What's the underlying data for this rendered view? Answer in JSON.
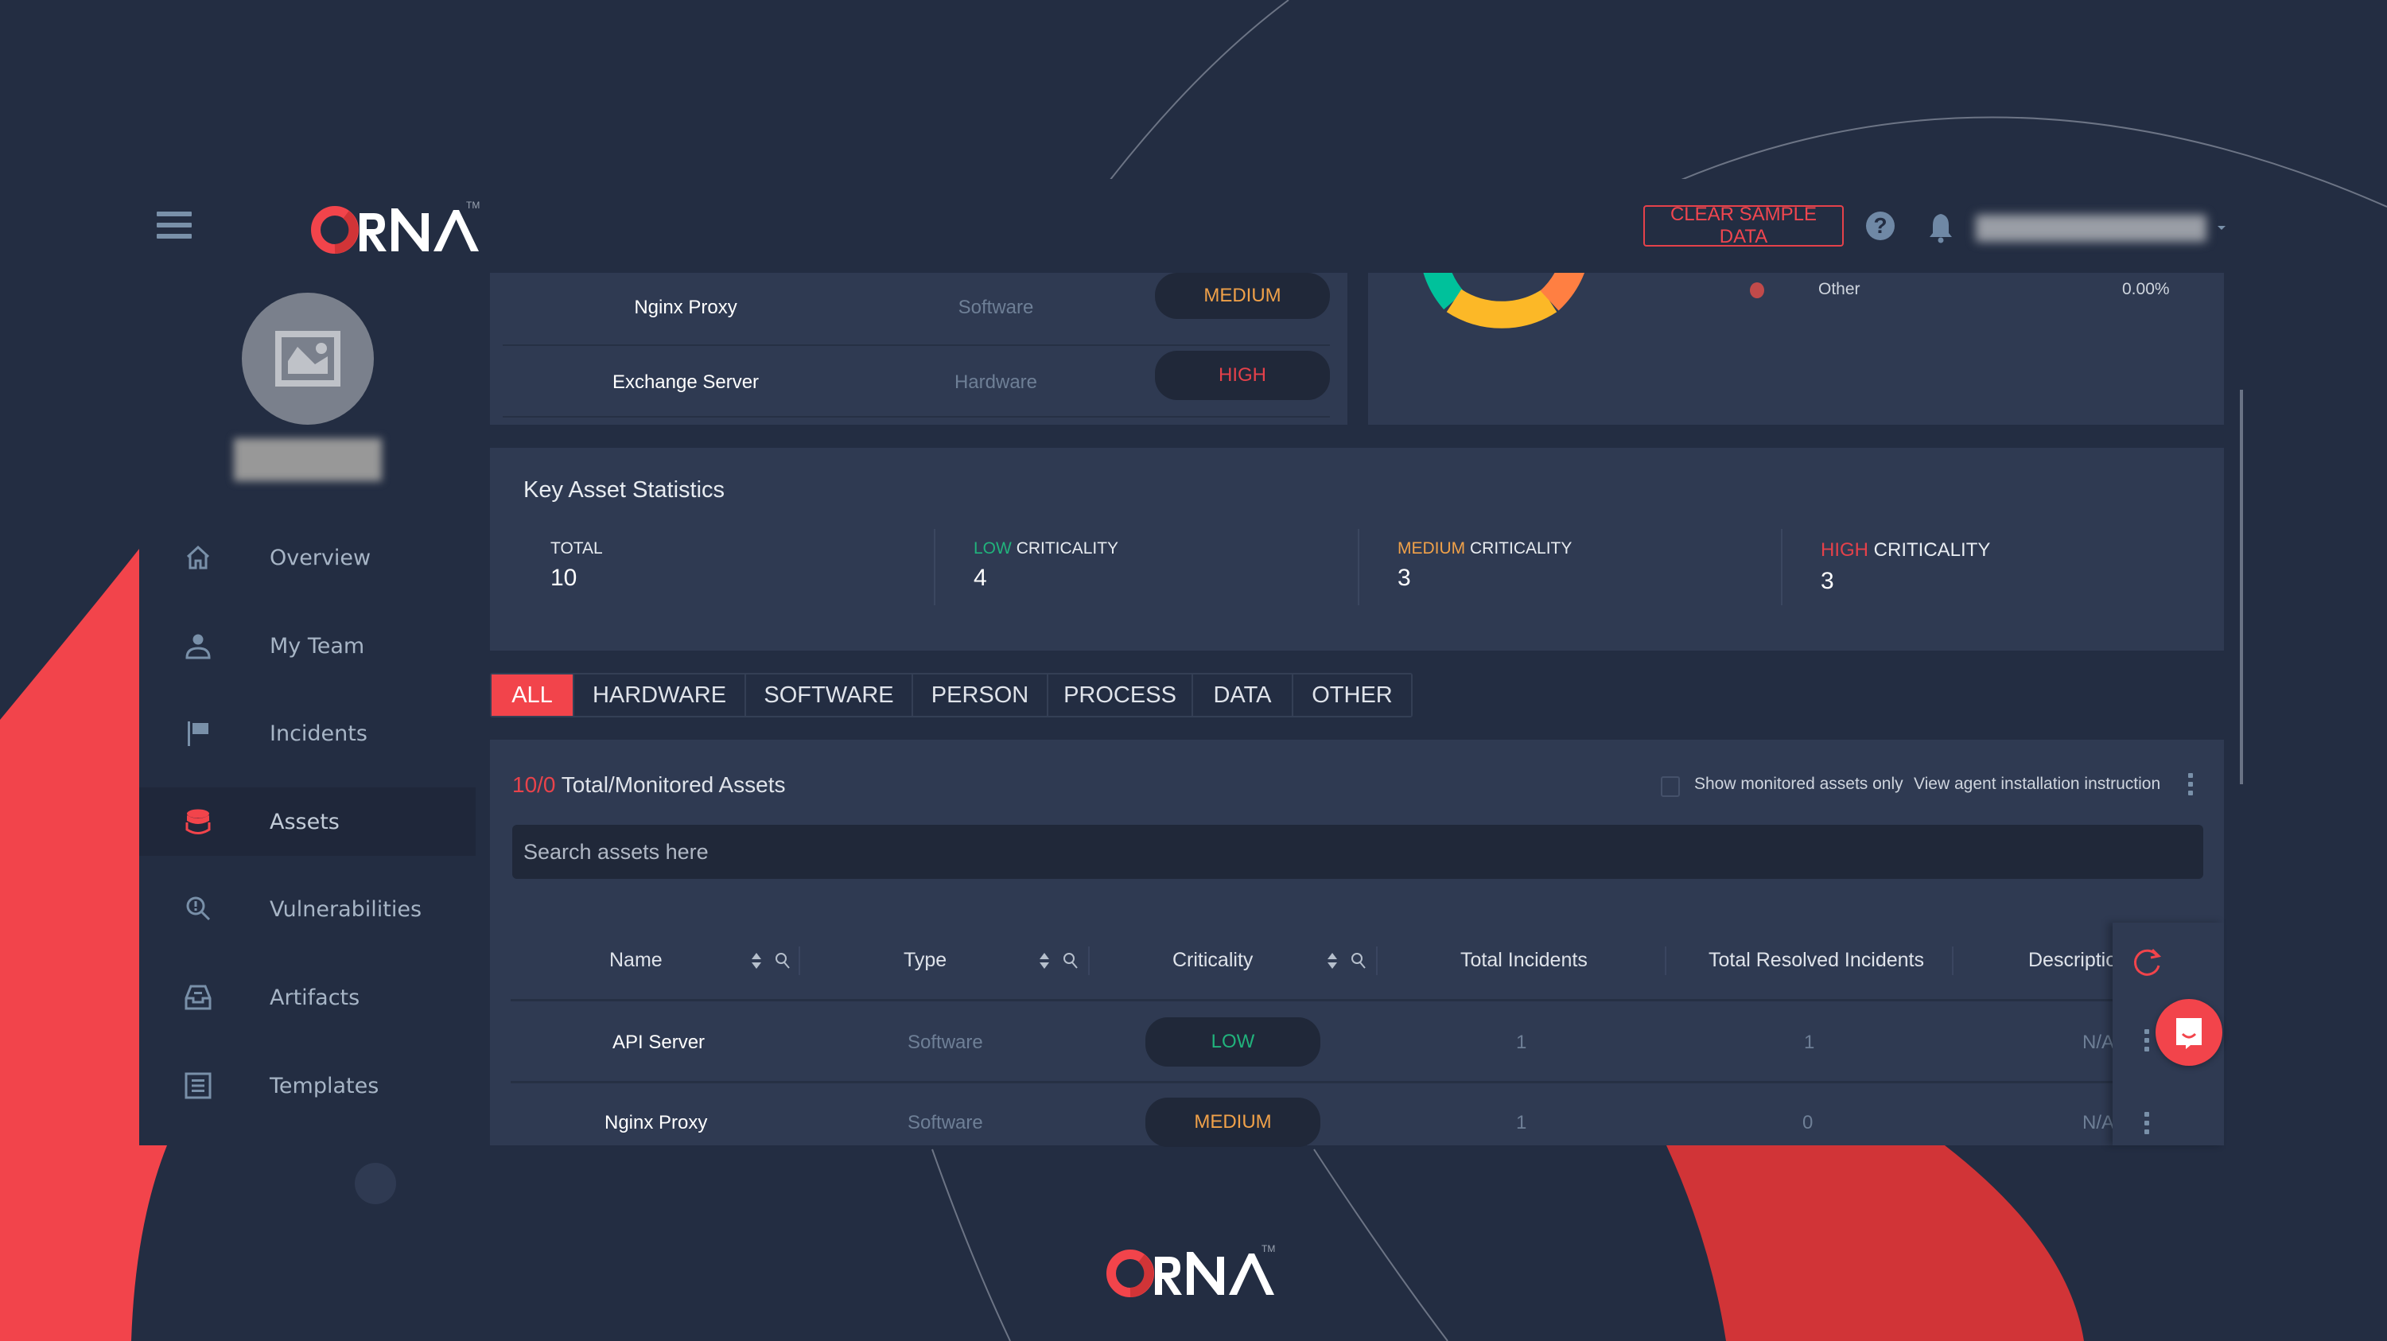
{
  "brand": {
    "name_first_letter": "O",
    "name_rest": "RNA",
    "trademark": "TM",
    "accent": "#f2444b"
  },
  "header": {
    "menu_icon": "hamburger-icon",
    "clear_sample_data": "CLEAR SAMPLE DATA",
    "help_icon": "help-icon",
    "help_glyph": "?",
    "notification_icon": "bell-icon",
    "user_email": "(blurred)"
  },
  "sidebar": {
    "avatar_icon": "image-placeholder-icon",
    "user_name": "(blurred)",
    "items": [
      {
        "label": "Overview",
        "icon": "home-icon",
        "active": false
      },
      {
        "label": "My Team",
        "icon": "user-icon",
        "active": false
      },
      {
        "label": "Incidents",
        "icon": "flag-icon",
        "active": false
      },
      {
        "label": "Assets",
        "icon": "database-icon",
        "active": true
      },
      {
        "label": "Vulnerabilities",
        "icon": "search-alert-icon",
        "active": false
      },
      {
        "label": "Artifacts",
        "icon": "inbox-icon",
        "active": false
      },
      {
        "label": "Templates",
        "icon": "document-list-icon",
        "active": false
      }
    ]
  },
  "top_assets_list": {
    "rows": [
      {
        "name": "Nginx Proxy",
        "type": "Software",
        "criticality": "MEDIUM"
      },
      {
        "name": "Exchange Server",
        "type": "Hardware",
        "criticality": "HIGH"
      }
    ]
  },
  "distribution_chart": {
    "legend": [
      {
        "label": "Other",
        "value": "0.00%",
        "color": "#c14a4a"
      }
    ],
    "visible_segment_colors": [
      "#00c19b",
      "#fcb827",
      "#ff7f42"
    ]
  },
  "key_stats": {
    "title": "Key Asset Statistics",
    "total_label": "TOTAL",
    "total_value": "10",
    "low_prefix": "LOW",
    "medium_prefix": "MEDIUM",
    "high_prefix": "HIGH",
    "criticality_suffix": "CRITICALITY",
    "low_value": "4",
    "medium_value": "3",
    "high_value": "3",
    "colors": {
      "low": "#21b37c",
      "medium": "#f0a149",
      "high": "#e5414a"
    }
  },
  "tabs": [
    {
      "label": "ALL",
      "active": true
    },
    {
      "label": "HARDWARE",
      "active": false
    },
    {
      "label": "SOFTWARE",
      "active": false
    },
    {
      "label": "PERSON",
      "active": false
    },
    {
      "label": "PROCESS",
      "active": false
    },
    {
      "label": "DATA",
      "active": false
    },
    {
      "label": "OTHER",
      "active": false
    }
  ],
  "assets": {
    "count": "10/0",
    "count_label": "Total/Monitored Assets",
    "monitored_only_label": "Show monitored assets only",
    "monitored_only_checked": false,
    "agent_instruction_link": "View agent installation instruction",
    "search_placeholder": "Search assets here",
    "search_value": "",
    "columns": [
      "Name",
      "Type",
      "Criticality",
      "Total Incidents",
      "Total Resolved Incidents",
      "Descriptio"
    ],
    "rows": [
      {
        "name": "API Server",
        "type": "Software",
        "criticality": "LOW",
        "total_incidents": "1",
        "resolved_incidents": "1",
        "description": "N/A"
      },
      {
        "name": "Nginx Proxy",
        "type": "Software",
        "criticality": "MEDIUM",
        "total_incidents": "1",
        "resolved_incidents": "0",
        "description": "N/A"
      }
    ]
  }
}
